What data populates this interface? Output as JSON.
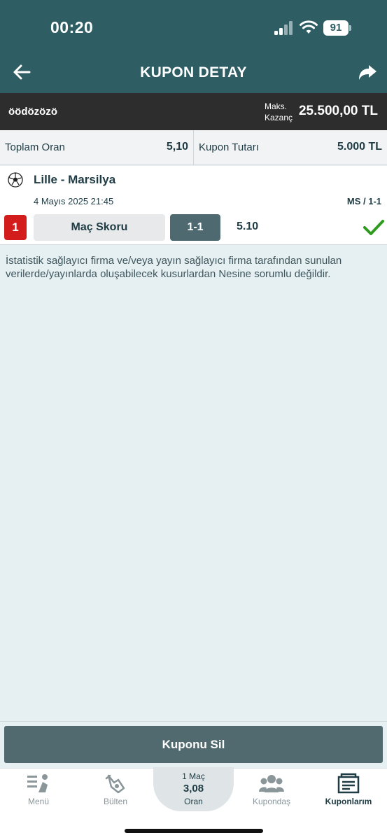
{
  "status_bar": {
    "time": "00:20",
    "battery": "91"
  },
  "header": {
    "title": "KUPON DETAY"
  },
  "coupon_bar": {
    "name": "öödözözö",
    "max_win_label_1": "Maks.",
    "max_win_label_2": "Kazanç",
    "max_win_value": "25.500,00 TL"
  },
  "summary": {
    "total_odds_label": "Toplam Oran",
    "total_odds_value": "5,10",
    "amount_label": "Kupon Tutarı",
    "amount_value": "5.000 TL"
  },
  "match": {
    "name": "Lille - Marsilya",
    "date": "4 Mayıs 2025 21:45",
    "market_code": "MS / 1-1",
    "bet_number": "1",
    "market": "Maç Skoru",
    "pick": "1-1",
    "odd": "5.10",
    "status_color": "#2e9a1e"
  },
  "disclaimer": "İstatistik sağlayıcı firma ve/veya yayın sağlayıcı firma tarafından sunulan verilerde/yayınlarda oluşabilecek kusurlardan Nesine sorumlu değildir.",
  "actions": {
    "delete_label": "Kuponu Sil"
  },
  "bottom_nav": {
    "items": [
      {
        "label": "Menü",
        "icon": "menu-icon"
      },
      {
        "label": "Bülten",
        "icon": "bulletin-icon"
      },
      {
        "label": "Kupondaş",
        "icon": "users-icon"
      },
      {
        "label": "Kuponlarım",
        "icon": "coupons-icon",
        "active": true
      }
    ],
    "center": {
      "top": "1 Maç",
      "odds": "3,08",
      "bottom": "Oran"
    }
  },
  "colors": {
    "header": "#2e5e64",
    "dark_bar": "#2d2d2d",
    "accent_red": "#d31d1d",
    "button": "#506a70"
  }
}
